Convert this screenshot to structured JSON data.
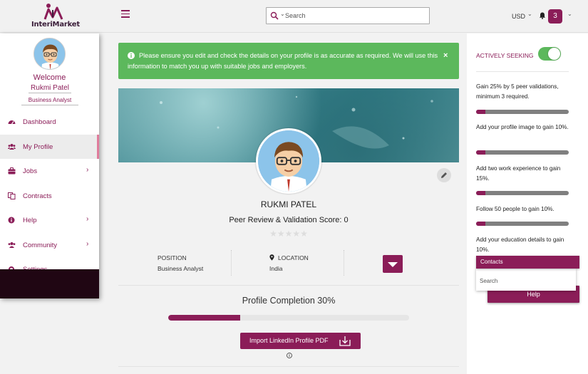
{
  "header": {
    "logo_text": "InteriMarket",
    "search_placeholder": "Search",
    "currency": "USD",
    "notification_count": "3"
  },
  "sidebar": {
    "welcome": "Welcome",
    "user_name": "Rukmi Patel",
    "user_role": "Business Analyst",
    "items": [
      {
        "label": "Dashboard",
        "icon": "dashboard-icon",
        "has_chevron": false
      },
      {
        "label": "My Profile",
        "icon": "users-icon",
        "has_chevron": false,
        "active": true
      },
      {
        "label": "Jobs",
        "icon": "briefcase-icon",
        "has_chevron": true
      },
      {
        "label": "Contracts",
        "icon": "copy-icon",
        "has_chevron": false
      },
      {
        "label": "Help",
        "icon": "info-icon",
        "has_chevron": true
      },
      {
        "label": "Community",
        "icon": "users-icon",
        "has_chevron": true
      },
      {
        "label": "Settings",
        "icon": "cogs-icon",
        "has_chevron": false
      }
    ]
  },
  "alert": {
    "text": "Please ensure you edit and check the details on your profile is as accurate as required. We will use this information to match you up with suitable jobs and employers.",
    "close": "×"
  },
  "profile": {
    "name": "RUKMI PATEL",
    "score_text": "Peer Review & Validation Score: 0",
    "stars": "★★★★★",
    "position_label": "POSITION",
    "position_value": "Business Analyst",
    "location_label": "LOCATION",
    "location_value": "India",
    "completion_title": "Profile Completion 30%",
    "completion_fraction": 0.3,
    "import_label": "Import LinkedIn Profile PDF"
  },
  "right_panel": {
    "seeking_label": "ACTIVELY SEEKING",
    "seeking_on": true,
    "tips": [
      {
        "text": "Gain 25% by 5 peer validations, minimum 3 required.",
        "progress": 0.1
      },
      {
        "text": "Add your profile image to gain 10%.",
        "progress": 0.1
      },
      {
        "text": "Add two work experience to gain 15%.",
        "progress": 0.1
      },
      {
        "text": "Follow 50 people to gain 10%.",
        "progress": 0.1
      },
      {
        "text": "Add your education details to gain 10%.",
        "progress": 0.1
      }
    ],
    "contacts_label": "Contacts",
    "contacts_search_placeholder": "Search",
    "help_label": "Help"
  },
  "colors": {
    "brand": "#8b1d58",
    "success": "#5cb85c",
    "dark": "#200613"
  }
}
